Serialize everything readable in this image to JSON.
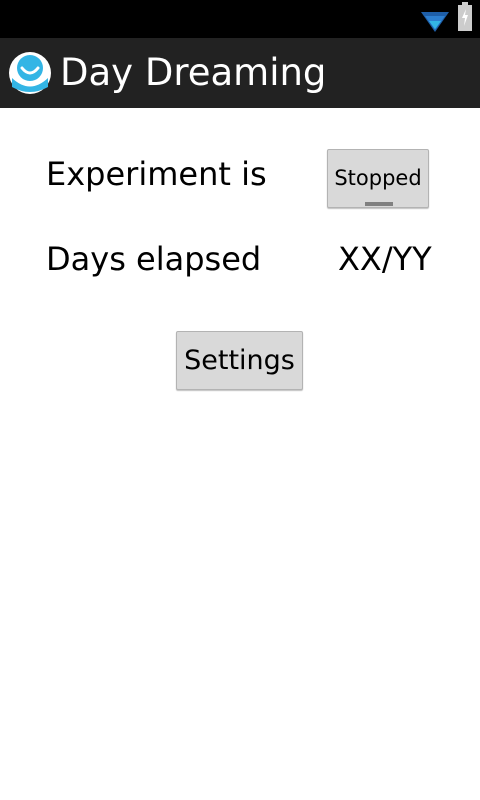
{
  "status_bar": {
    "icons": [
      "wifi-icon",
      "battery-charging-icon"
    ],
    "wifi_color": "#33b5e5"
  },
  "action_bar": {
    "title": "Day Dreaming",
    "icon": "app-logo-icon",
    "background": "#222222",
    "logo_color": "#33b5e5"
  },
  "experiment": {
    "label": "Experiment is",
    "toggle_label": "Stopped",
    "toggle_state": "off"
  },
  "days": {
    "label": "Days elapsed",
    "value": "XX/YY"
  },
  "settings": {
    "button_label": "Settings"
  }
}
